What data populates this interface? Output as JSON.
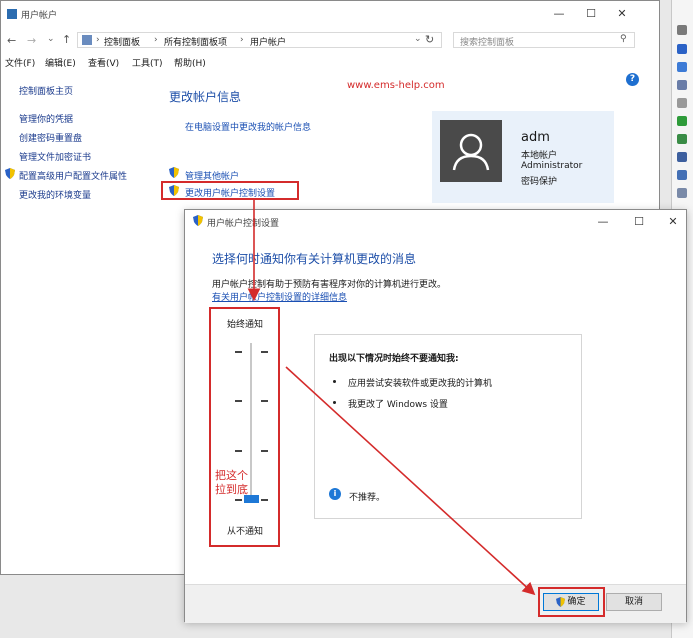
{
  "window": {
    "title": "用户帐户",
    "breadcrumb": [
      "控制面板",
      "所有控制面板项",
      "用户帐户"
    ],
    "search_placeholder": "搜索控制面板",
    "menu": [
      "文件(F)",
      "编辑(E)",
      "查看(V)",
      "工具(T)",
      "帮助(H)"
    ]
  },
  "watermark": "www.ems-help.com",
  "sidebar": {
    "items": [
      "控制面板主页",
      "管理你的凭据",
      "创建密码重置盘",
      "管理文件加密证书",
      "配置高级用户配置文件属性",
      "更改我的环境变量"
    ]
  },
  "content": {
    "heading": "更改帐户信息",
    "link_settings": "在电脑设置中更改我的帐户信息",
    "link_manage": "管理其他帐户",
    "link_uac": "更改用户帐户控制设置"
  },
  "user": {
    "name": "adm",
    "details": [
      "本地帐户",
      "Administrator",
      "密码保护"
    ]
  },
  "dialog": {
    "title": "用户帐户控制设置",
    "heading": "选择何时通知你有关计算机更改的消息",
    "description": "用户帐户控制有助于预防有害程序对你的计算机进行更改。",
    "more_link": "有关用户帐户控制设置的详细信息",
    "slider_top": "始终通知",
    "slider_bottom": "从不通知",
    "slider_level": 0,
    "slider_levels": 4,
    "annotation": [
      "把这个",
      "拉到底"
    ],
    "info_title": "出现以下情况时始终不要通知我:",
    "info_items": [
      "应用尝试安装软件或更改我的计算机",
      "我更改了 Windows 设置"
    ],
    "info_note": "不推荐。",
    "ok_label": "确定",
    "cancel_label": "取消"
  },
  "colors": {
    "annotation_red": "#d42b2b",
    "link_blue": "#1a4fb3",
    "heading_blue": "#1e4fa8",
    "slider_thumb": "#1e78d6"
  }
}
